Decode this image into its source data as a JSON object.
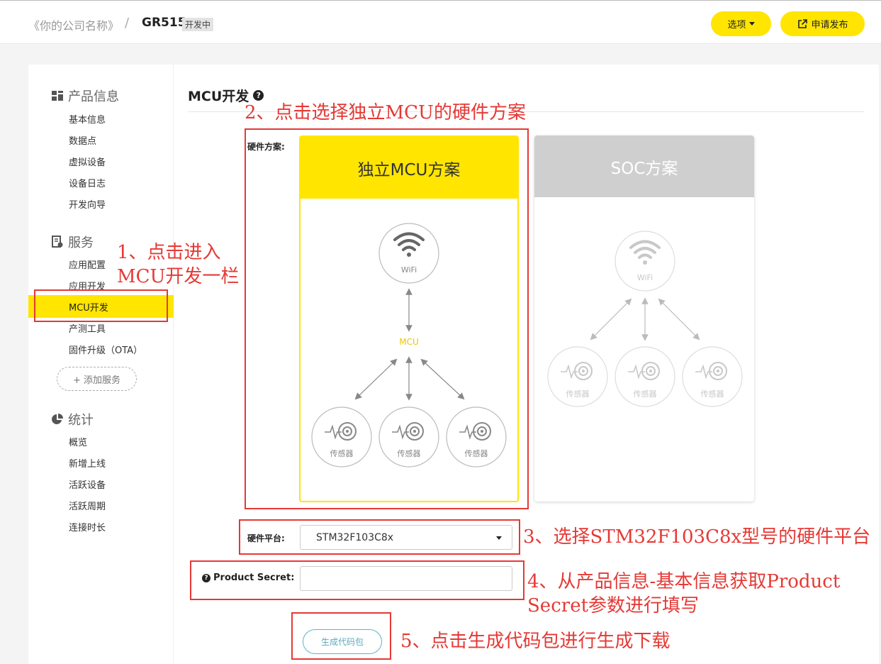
{
  "header": {
    "company": "《你的公司名称》",
    "separator": "/",
    "product": "GR515",
    "status_badge": "开发中",
    "options_label": "选项",
    "publish_label": "申请发布"
  },
  "sidebar": {
    "sections": [
      {
        "title": "产品信息",
        "icon": "grid-icon",
        "items": [
          "基本信息",
          "数据点",
          "虚拟设备",
          "设备日志",
          "开发向导"
        ]
      },
      {
        "title": "服务",
        "icon": "service-icon",
        "items": [
          "应用配置",
          "应用开发",
          "MCU开发",
          "产测工具",
          "固件升级（OTA）"
        ]
      },
      {
        "title": "统计",
        "icon": "pie-chart-icon",
        "items": [
          "概览",
          "新增上线",
          "活跃设备",
          "活跃周期",
          "连接时长"
        ]
      }
    ],
    "active_item": "MCU开发",
    "add_service_label": "+ 添加服务"
  },
  "main": {
    "title": "MCU开发",
    "hardware_scheme_label": "硬件方案:",
    "scheme_mcu": {
      "title": "独立MCU方案",
      "wifi_label": "WiFi",
      "mcu_label": "MCU",
      "sensor_label": "传感器"
    },
    "scheme_soc": {
      "title": "SOC方案",
      "wifi_label": "WiFi",
      "sensor_label": "传感器"
    },
    "hardware_platform_label": "硬件平台:",
    "hardware_platform_value": "STM32F103C8x",
    "product_secret_label": "Product Secret:",
    "product_secret_value": "",
    "generate_button": "生成代码包"
  },
  "annotations": {
    "step1_line1": "1、点击进入",
    "step1_line2": "MCU开发一栏",
    "step2": "2、点击选择独立MCU的硬件方案",
    "step3": "3、选择STM32F103C8x型号的硬件平台",
    "step4_line1": "4、从产品信息-基本信息获取Product",
    "step4_line2": "Secret参数进行填写",
    "step5": "5、点击生成代码包进行生成下载"
  },
  "colors": {
    "accent_yellow": "#ffe500",
    "annotation_red": "#e53935",
    "button_teal": "#5bb5c4",
    "soc_gray": "#cfcfcf"
  }
}
